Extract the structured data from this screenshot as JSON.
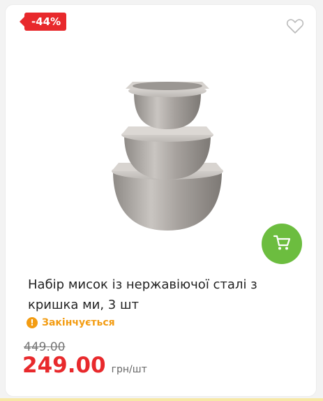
{
  "product": {
    "discount_badge": "-44%",
    "title": "Набір мисок із нержавіючої сталі з кришка ми, 3 шт",
    "status": "Закінчується",
    "old_price": "449.00",
    "price": "249.00",
    "unit": "грн/шт",
    "image_icon": "bowls-set-image"
  },
  "icons": {
    "favorite": "heart-outline-icon",
    "cart": "shopping-cart-icon",
    "status": "exclamation-circle-icon"
  },
  "colors": {
    "accent_red": "#e8292c",
    "cart_green": "#6cbd3f",
    "status_orange": "#f39c12"
  }
}
